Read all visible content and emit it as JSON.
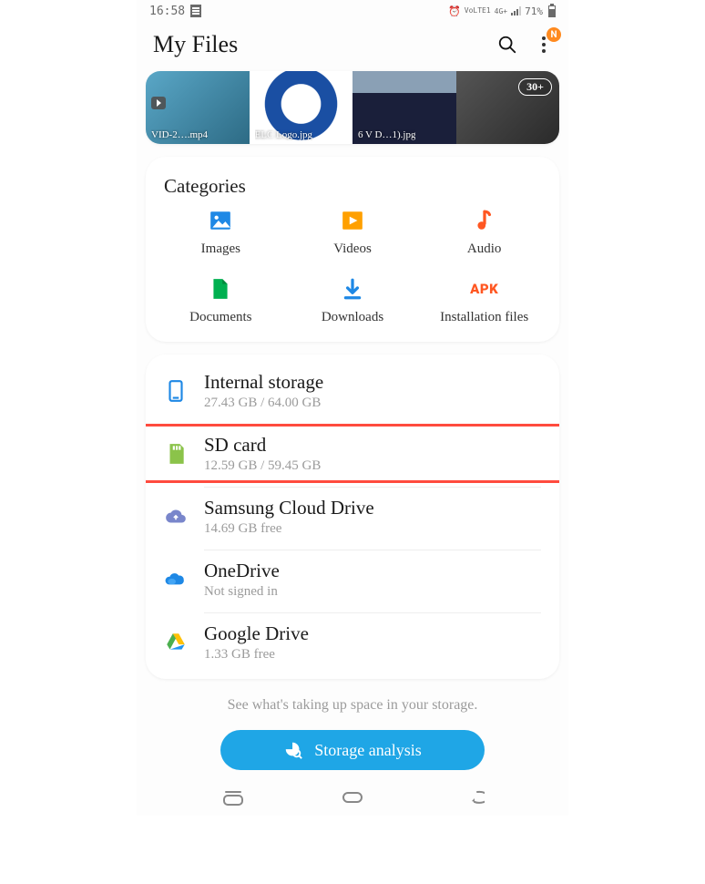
{
  "status": {
    "time": "16:58",
    "net_label": "VoLTE1",
    "net_sub": "4G+",
    "battery_pct": "71%"
  },
  "header": {
    "title": "My Files",
    "badge": "N"
  },
  "recent": {
    "items": [
      {
        "label": "VID-2….mp4"
      },
      {
        "label": "ELC Logo.jpg"
      },
      {
        "label": "6 V D…1).jpg"
      },
      {
        "label": ""
      }
    ],
    "more_count": "30+"
  },
  "categories": {
    "heading": "Categories",
    "items": [
      {
        "label": "Images"
      },
      {
        "label": "Videos"
      },
      {
        "label": "Audio"
      },
      {
        "label": "Documents"
      },
      {
        "label": "Downloads"
      },
      {
        "label": "Installation files"
      }
    ]
  },
  "storage": [
    {
      "title": "Internal storage",
      "sub": "27.43 GB / 64.00 GB"
    },
    {
      "title": "SD card",
      "sub": "12.59 GB / 59.45 GB"
    },
    {
      "title": "Samsung Cloud Drive",
      "sub": "14.69 GB free"
    },
    {
      "title": "OneDrive",
      "sub": "Not signed in"
    },
    {
      "title": "Google Drive",
      "sub": "1.33 GB free"
    }
  ],
  "footer": {
    "hint": "See what's taking up space in your storage.",
    "button": "Storage analysis"
  }
}
